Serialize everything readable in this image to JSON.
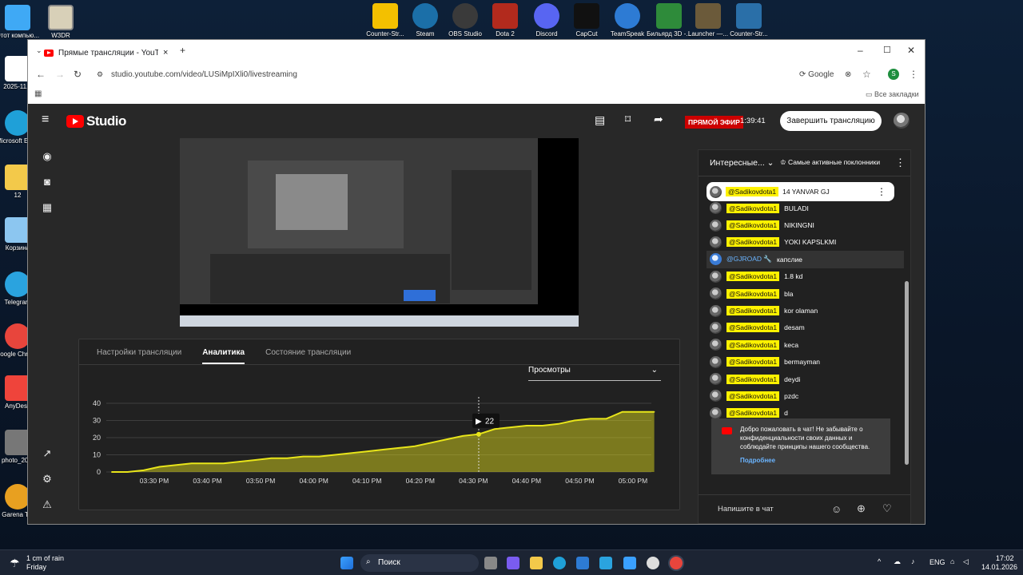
{
  "desktop": {
    "top_icons": [
      {
        "label": "Counter-Str...",
        "icon": "csgo-icon",
        "color": "#f3c000"
      },
      {
        "label": "Steam",
        "icon": "steam-icon",
        "color": "#1b6fa8"
      },
      {
        "label": "OBS Studio",
        "icon": "obs-icon",
        "color": "#3a3a3a"
      },
      {
        "label": "Dota 2",
        "icon": "dota-icon",
        "color": "#b22a1d"
      },
      {
        "label": "Discord",
        "icon": "discord-icon",
        "color": "#5865f2"
      },
      {
        "label": "CapCut",
        "icon": "capcut-icon",
        "color": "#111111"
      },
      {
        "label": "TeamSpeak",
        "icon": "teamspeak-icon",
        "color": "#2d7bd4"
      },
      {
        "label": "Бильярд 3D -...",
        "icon": "billiard-icon",
        "color": "#2e8b3a"
      },
      {
        "label": "Launcher —...",
        "icon": "launcher-icon",
        "color": "#6b5a3a"
      },
      {
        "label": "Counter-Str...",
        "icon": "csgo-icon",
        "color": "#2a6fa8"
      }
    ],
    "left_icons": [
      {
        "label": "Этот компью...",
        "icon": "computer-icon",
        "color": "#3fa9f5"
      },
      {
        "label": "2025-11...",
        "icon": "file-icon",
        "color": "#ffffff"
      },
      {
        "label": "Microsoft Edge",
        "icon": "edge-icon",
        "color": "#1fa0d8"
      },
      {
        "label": "12",
        "icon": "folder-icon",
        "color": "#f3c94a"
      },
      {
        "label": "Корзина",
        "icon": "recycle-bin-icon",
        "color": "#8cc6f0"
      },
      {
        "label": "Telegram",
        "icon": "telegram-icon",
        "color": "#2aa3df"
      },
      {
        "label": "Google Chrome",
        "icon": "chrome-icon",
        "color": "#e8453c"
      },
      {
        "label": "AnyDesk",
        "icon": "anydesk-icon",
        "color": "#ef443b"
      },
      {
        "label": "photo_20...",
        "icon": "photo-icon",
        "color": "#777777"
      },
      {
        "label": "Garena T...",
        "icon": "garena-icon",
        "color": "#e8a020"
      }
    ],
    "w3dr_label": "W3DR"
  },
  "browser": {
    "tab_title": "Прямые трансляции - YouTube",
    "url": "studio.youtube.com/video/LUSiMpIXli0/livestreaming",
    "search_engine": "Google",
    "profile_letter": "S",
    "bookmarks_label": "Все закладки"
  },
  "studio": {
    "logo_text": "Studio",
    "live_badge": "ПРЯМОЙ ЭФИР",
    "timer": "1:39:41",
    "end_button": "Завершить трансляцию",
    "tabs": [
      "Настройки трансляции",
      "Аналитика",
      "Состояние трансляции"
    ],
    "active_tab": 1,
    "metric_select": "Просмотры",
    "tooltip_value": "22"
  },
  "chart_data": {
    "type": "area",
    "ylim": [
      0,
      40
    ],
    "yticks": [
      0,
      10,
      20,
      30,
      40
    ],
    "x_tick_labels": [
      "03:30 PM",
      "03:40 PM",
      "03:50 PM",
      "04:00 PM",
      "04:10 PM",
      "04:20 PM",
      "04:30 PM",
      "04:40 PM",
      "04:50 PM",
      "05:00 PM"
    ],
    "series": [
      {
        "color": "#e8e51a",
        "x": [
          "03:22 PM",
          "03:25 PM",
          "03:28 PM",
          "03:31 PM",
          "03:34 PM",
          "03:37 PM",
          "03:40 PM",
          "03:43 PM",
          "03:46 PM",
          "03:49 PM",
          "03:52 PM",
          "03:55 PM",
          "03:58 PM",
          "04:01 PM",
          "04:04 PM",
          "04:07 PM",
          "04:10 PM",
          "04:13 PM",
          "04:16 PM",
          "04:19 PM",
          "04:22 PM",
          "04:25 PM",
          "04:28 PM",
          "04:31 PM",
          "04:34 PM",
          "04:37 PM",
          "04:40 PM",
          "04:43 PM",
          "04:46 PM",
          "04:49 PM",
          "04:52 PM",
          "04:55 PM",
          "04:58 PM",
          "05:01 PM",
          "05:04 PM"
        ],
        "values": [
          0,
          0,
          1,
          3,
          4,
          5,
          5,
          5,
          6,
          7,
          8,
          8,
          9,
          9,
          10,
          11,
          12,
          13,
          14,
          15,
          17,
          19,
          21,
          22,
          25,
          26,
          27,
          27,
          28,
          30,
          31,
          31,
          35,
          35,
          35
        ]
      }
    ],
    "hover_x": "04:31 PM",
    "grid": true
  },
  "chat": {
    "header_title": "Интересные...",
    "top_fans": "Самые активные поклонники",
    "pinned": {
      "author": "@Sadikovdota1",
      "text": "14 YANVAR GJ"
    },
    "messages": [
      {
        "author": "@Sadikovdota1",
        "text": "BULADI",
        "mod": false
      },
      {
        "author": "@Sadikovdota1",
        "text": "NIKINGNI",
        "mod": false
      },
      {
        "author": "@Sadikovdota1",
        "text": "YOKI KAPSLKMI",
        "mod": false
      },
      {
        "author": "@GJROAD 🔧",
        "text": "капслие",
        "mod": true
      },
      {
        "author": "@Sadikovdota1",
        "text": "1.8 kd",
        "mod": false
      },
      {
        "author": "@Sadikovdota1",
        "text": "bla",
        "mod": false
      },
      {
        "author": "@Sadikovdota1",
        "text": "kor olaman",
        "mod": false
      },
      {
        "author": "@Sadikovdota1",
        "text": "desam",
        "mod": false
      },
      {
        "author": "@Sadikovdota1",
        "text": "keca",
        "mod": false
      },
      {
        "author": "@Sadikovdota1",
        "text": "bermayman",
        "mod": false
      },
      {
        "author": "@Sadikovdota1",
        "text": "deydi",
        "mod": false
      },
      {
        "author": "@Sadikovdota1",
        "text": "pzdc",
        "mod": false
      },
      {
        "author": "@Sadikovdota1",
        "text": "d",
        "mod": false
      }
    ],
    "welcome_text": "Добро пожаловать в чат! Не забывайте о конфиденциальности своих данных и соблюдайте принципы нашего сообщества.",
    "welcome_link": "Подробнее",
    "input_placeholder": "Напишите в чат"
  },
  "taskbar": {
    "weather_temp": "1 cm of rain",
    "weather_day": "Friday",
    "search_label": "Поиск",
    "lang": "ENG",
    "time": "17:02",
    "date": "14.01.2026"
  }
}
